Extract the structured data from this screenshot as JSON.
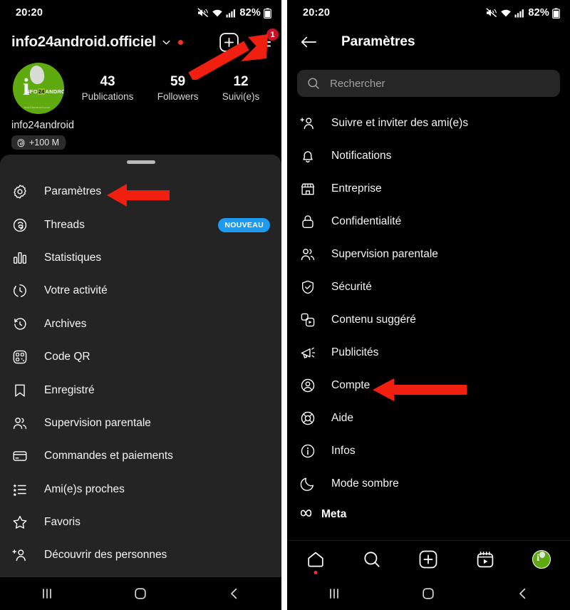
{
  "status_bar": {
    "time": "20:20",
    "battery_percent": "82%",
    "icons": [
      "mute-icon",
      "wifi-icon",
      "signal-icon",
      "battery-icon"
    ]
  },
  "left_screen": {
    "profile": {
      "account_name": "info24android.officiel",
      "has_unread_dot": true,
      "new_post_button": "add-post",
      "menu_badge_count": "1",
      "username": "info24android",
      "threads_chip": "+100 M",
      "stats": [
        {
          "value": "43",
          "label": "Publications"
        },
        {
          "value": "59",
          "label": "Followers"
        },
        {
          "value": "12",
          "label": "Suivi(e)s"
        }
      ]
    },
    "sheet_menu": [
      {
        "icon": "settings-gear-icon",
        "label": "Paramètres",
        "badge": ""
      },
      {
        "icon": "threads-icon",
        "label": "Threads",
        "badge": "NOUVEAU"
      },
      {
        "icon": "bar-chart-icon",
        "label": "Statistiques",
        "badge": ""
      },
      {
        "icon": "activity-clock-icon",
        "label": "Votre activité",
        "badge": ""
      },
      {
        "icon": "archive-clock-icon",
        "label": "Archives",
        "badge": ""
      },
      {
        "icon": "qr-code-icon",
        "label": "Code QR",
        "badge": ""
      },
      {
        "icon": "bookmark-icon",
        "label": "Enregistré",
        "badge": ""
      },
      {
        "icon": "people-icon",
        "label": "Supervision parentale",
        "badge": ""
      },
      {
        "icon": "credit-card-icon",
        "label": "Commandes et paiements",
        "badge": ""
      },
      {
        "icon": "close-friends-list-icon",
        "label": "Ami(e)s proches",
        "badge": ""
      },
      {
        "icon": "star-icon",
        "label": "Favoris",
        "badge": ""
      },
      {
        "icon": "add-person-icon",
        "label": "Découvrir des personnes",
        "badge": ""
      }
    ]
  },
  "right_screen": {
    "header": {
      "back": "back-arrow",
      "title": "Paramètres"
    },
    "search": {
      "placeholder": "Rechercher",
      "value": ""
    },
    "settings_items": [
      {
        "icon": "add-person-icon",
        "label": "Suivre et inviter des ami(e)s"
      },
      {
        "icon": "bell-icon",
        "label": "Notifications"
      },
      {
        "icon": "storefront-icon",
        "label": "Entreprise"
      },
      {
        "icon": "lock-icon",
        "label": "Confidentialité"
      },
      {
        "icon": "people-icon",
        "label": "Supervision parentale"
      },
      {
        "icon": "shield-check-icon",
        "label": "Sécurité"
      },
      {
        "icon": "suggested-content-icon",
        "label": "Contenu suggéré"
      },
      {
        "icon": "megaphone-icon",
        "label": "Publicités"
      },
      {
        "icon": "account-circle-icon",
        "label": "Compte"
      },
      {
        "icon": "lifebuoy-icon",
        "label": "Aide"
      },
      {
        "icon": "info-icon",
        "label": "Infos"
      },
      {
        "icon": "moon-icon",
        "label": "Mode sombre"
      }
    ],
    "meta_footer": {
      "icon": "meta-infinity-icon",
      "label": "Meta"
    },
    "tabbar": [
      {
        "icon": "home-icon",
        "active": true
      },
      {
        "icon": "search-icon",
        "active": false
      },
      {
        "icon": "add-box-icon",
        "active": false
      },
      {
        "icon": "reels-icon",
        "active": false
      },
      {
        "icon": "profile-avatar-icon",
        "active": false
      }
    ]
  },
  "android_nav": [
    {
      "icon": "recents-icon"
    },
    {
      "icon": "home-square-icon"
    },
    {
      "icon": "back-chevron-icon"
    }
  ],
  "annotations": {
    "arrow_color": "#f01f10",
    "arrows": [
      {
        "name": "arrow-to-hamburger-menu",
        "points_to": "menu-button"
      },
      {
        "name": "arrow-to-parametres",
        "points_to": "sheet-item-parametres"
      },
      {
        "name": "arrow-to-compte",
        "points_to": "settings-item-compte"
      }
    ]
  },
  "colors": {
    "sheet_bg": "#242424",
    "screen_bg": "#000000",
    "badge_new": "#1d9bf0",
    "badge_count": "#c9122a",
    "avatar_green": "#5faa0f",
    "accent_red_dot": "#e8342a"
  }
}
